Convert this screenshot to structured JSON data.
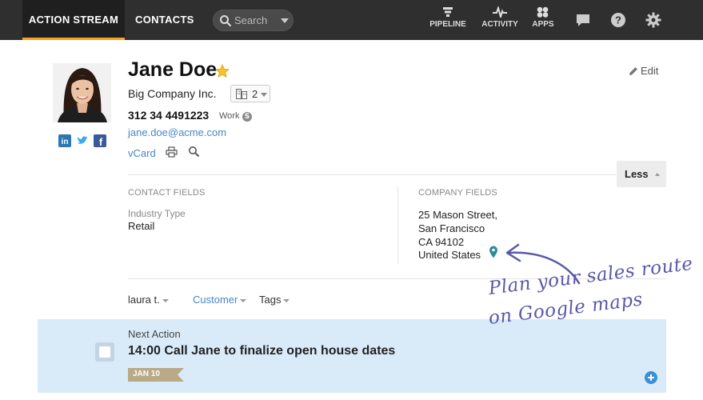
{
  "nav": {
    "tabs": [
      {
        "label": "ACTION STREAM"
      },
      {
        "label": "CONTACTS"
      }
    ],
    "search": {
      "placeholder": "Search"
    },
    "icons": [
      {
        "label": "PIPELINE",
        "icon": "pipeline-icon"
      },
      {
        "label": "ACTIVITY",
        "icon": "activity-icon"
      },
      {
        "label": "APPS",
        "icon": "apps-icon"
      }
    ],
    "accent": "#f5a31a"
  },
  "contact": {
    "name": "Jane Doe",
    "company": "Big Company Inc.",
    "company_count": "2",
    "phone": "312 34 4491223",
    "phone_type": "Work",
    "email": "jane.doe@acme.com",
    "vcard": "vCard",
    "edit": "Edit",
    "less": "Less"
  },
  "fields": {
    "contact_heading": "CONTACT FIELDS",
    "company_heading": "COMPANY FIELDS",
    "industry_label": "Industry Type",
    "industry_value": "Retail",
    "address": [
      "25 Mason Street,",
      "San Francisco",
      "CA 94102",
      "United States"
    ]
  },
  "meta": {
    "owner": "laura t.",
    "status": "Customer",
    "tags": "Tags"
  },
  "annotation": {
    "line1": "Plan your sales route",
    "line2": "on Google maps"
  },
  "next_action": {
    "label": "Next Action",
    "title": "14:00 Call Jane to finalize open house dates",
    "date": "JAN 10"
  }
}
